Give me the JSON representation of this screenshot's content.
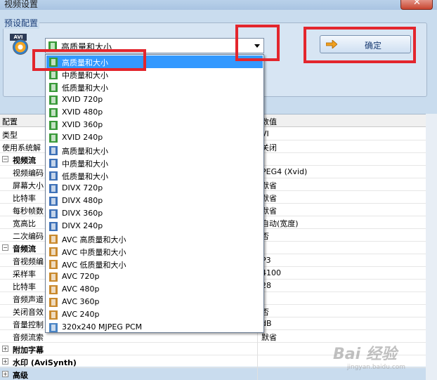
{
  "window": {
    "title": "视频设置"
  },
  "preset": {
    "group_label": "预设配置",
    "icon_tag": "AVI",
    "selected": "高质量和大小",
    "ok_label": "确定"
  },
  "grid": {
    "col_name": "配置",
    "col_value": "数值",
    "rows": [
      {
        "name": "类型",
        "value": "VI",
        "indent": 0,
        "section": false
      },
      {
        "name": "使用系统解",
        "value": "关闭",
        "indent": 0,
        "section": false
      },
      {
        "name": "视频流",
        "value": "",
        "indent": 1,
        "section": true,
        "expander": "−"
      },
      {
        "name": "视频编码",
        "value": "PEG4 (Xvid)",
        "indent": 2,
        "section": false
      },
      {
        "name": "屏幕大小",
        "value": "默省",
        "indent": 2,
        "section": false
      },
      {
        "name": "比特率",
        "value": "默省",
        "indent": 2,
        "section": false
      },
      {
        "name": "每秒帧数",
        "value": "默省",
        "indent": 2,
        "section": false
      },
      {
        "name": "宽高比",
        "value": "自动(宽度)",
        "indent": 2,
        "section": false
      },
      {
        "name": "二次编码",
        "value": "否",
        "indent": 2,
        "section": false
      },
      {
        "name": "音频流",
        "value": "",
        "indent": 1,
        "section": true,
        "expander": "−"
      },
      {
        "name": "音视频编",
        "value": "P3",
        "indent": 2,
        "section": false
      },
      {
        "name": "采样率",
        "value": "4100",
        "indent": 2,
        "section": false
      },
      {
        "name": "比特率",
        "value": "28",
        "indent": 2,
        "section": false
      },
      {
        "name": "音频声道",
        "value": "",
        "indent": 2,
        "section": false
      },
      {
        "name": "关闭音效",
        "value": "否",
        "indent": 2,
        "section": false
      },
      {
        "name": "音量控制",
        "value": "dB",
        "indent": 2,
        "section": false
      },
      {
        "name": "音频流索",
        "value": "默省",
        "indent": 2,
        "section": false
      },
      {
        "name": "附加字幕",
        "value": "",
        "indent": 1,
        "section": true,
        "expander": "+"
      },
      {
        "name": "水印 (AviSynth)",
        "value": "",
        "indent": 1,
        "section": true,
        "expander": "+"
      },
      {
        "name": "高级",
        "value": "",
        "indent": 1,
        "section": true,
        "expander": "+"
      }
    ]
  },
  "dropdown": {
    "items": [
      {
        "label": "高质量和大小",
        "icon": "green-film-icon",
        "color": "#3a9a3a",
        "selected": true
      },
      {
        "label": "中质量和大小",
        "icon": "green-film-icon",
        "color": "#3a9a3a",
        "selected": false
      },
      {
        "label": "低质量和大小",
        "icon": "green-film-icon",
        "color": "#3a9a3a",
        "selected": false
      },
      {
        "label": "XVID 720p",
        "icon": "green-film-icon",
        "color": "#3a9a3a",
        "selected": false
      },
      {
        "label": "XVID 480p",
        "icon": "green-film-icon",
        "color": "#3a9a3a",
        "selected": false
      },
      {
        "label": "XVID 360p",
        "icon": "green-film-icon",
        "color": "#3a9a3a",
        "selected": false
      },
      {
        "label": "XVID 240p",
        "icon": "green-film-icon",
        "color": "#3a9a3a",
        "selected": false
      },
      {
        "label": "高质量和大小",
        "icon": "blue-film-icon",
        "color": "#3f72b8",
        "selected": false
      },
      {
        "label": "中质量和大小",
        "icon": "blue-film-icon",
        "color": "#3f72b8",
        "selected": false
      },
      {
        "label": "低质量和大小",
        "icon": "blue-film-icon",
        "color": "#3f72b8",
        "selected": false
      },
      {
        "label": "DIVX 720p",
        "icon": "blue-film-icon",
        "color": "#3f72b8",
        "selected": false
      },
      {
        "label": "DIVX 480p",
        "icon": "blue-film-icon",
        "color": "#3f72b8",
        "selected": false
      },
      {
        "label": "DIVX 360p",
        "icon": "blue-film-icon",
        "color": "#3f72b8",
        "selected": false
      },
      {
        "label": "DIVX 240p",
        "icon": "blue-film-icon",
        "color": "#3f72b8",
        "selected": false
      },
      {
        "label": "AVC 高质量和大小",
        "icon": "orange-film-icon",
        "color": "#c98a2e",
        "selected": false
      },
      {
        "label": "AVC 中质量和大小",
        "icon": "orange-film-icon",
        "color": "#c98a2e",
        "selected": false
      },
      {
        "label": "AVC 低质量和大小",
        "icon": "orange-film-icon",
        "color": "#c98a2e",
        "selected": false
      },
      {
        "label": "AVC 720p",
        "icon": "orange-film-icon",
        "color": "#c98a2e",
        "selected": false
      },
      {
        "label": "AVC 480p",
        "icon": "orange-film-icon",
        "color": "#c98a2e",
        "selected": false
      },
      {
        "label": "AVC 360p",
        "icon": "orange-film-icon",
        "color": "#c98a2e",
        "selected": false
      },
      {
        "label": "AVC 240p",
        "icon": "orange-film-icon",
        "color": "#c98a2e",
        "selected": false
      },
      {
        "label": "320x240 MJPEG PCM",
        "icon": "blue-film-icon",
        "color": "#4a84c4",
        "selected": false
      }
    ]
  },
  "watermark": {
    "text": "Bai 经验",
    "sub": "jingyan.baidu.com"
  },
  "colors": {
    "highlight": "#e3262d",
    "selection": "#3399ff"
  }
}
